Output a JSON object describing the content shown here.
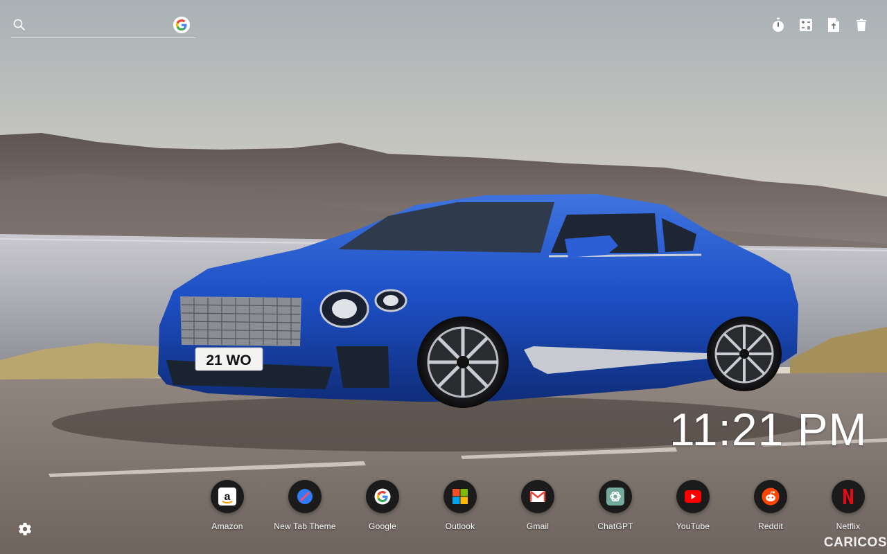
{
  "search": {
    "placeholder": "",
    "value": "",
    "engine_icon": "google-icon"
  },
  "toolbar": {
    "items": [
      {
        "icon": "stopwatch-icon"
      },
      {
        "icon": "calculator-icon"
      },
      {
        "icon": "document-icon"
      },
      {
        "icon": "trash-icon"
      }
    ]
  },
  "clock": {
    "time": "11:21 PM"
  },
  "plate": {
    "text": "21 WO"
  },
  "shortcuts": [
    {
      "label": "Amazon",
      "icon": "amazon-icon"
    },
    {
      "label": "New Tab Theme",
      "icon": "new-tab-theme-icon"
    },
    {
      "label": "Google",
      "icon": "google-icon"
    },
    {
      "label": "Outlook",
      "icon": "microsoft-icon"
    },
    {
      "label": "Gmail",
      "icon": "gmail-icon"
    },
    {
      "label": "ChatGPT",
      "icon": "chatgpt-icon"
    },
    {
      "label": "YouTube",
      "icon": "youtube-icon"
    },
    {
      "label": "Reddit",
      "icon": "reddit-icon"
    },
    {
      "label": "Netflix",
      "icon": "netflix-icon"
    }
  ],
  "settings": {
    "icon": "gear-icon"
  },
  "watermark": {
    "text": "CARICOS"
  },
  "colors": {
    "car_blue": "#1d4fc4",
    "sky": "#d8d0c2",
    "road": "#8c8178",
    "dock_circle": "#1b1b1b"
  }
}
